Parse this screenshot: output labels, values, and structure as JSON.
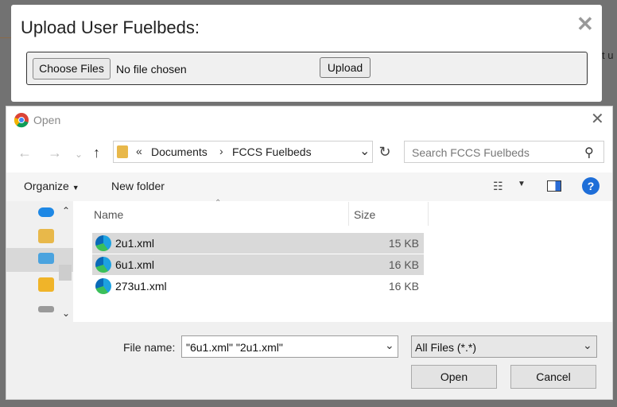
{
  "modal": {
    "title": "Upload User Fuelbeds:",
    "close_glyph": "✕",
    "choose_files_label": "Choose Files",
    "no_file_text": "No file chosen",
    "upload_label": "Upload"
  },
  "background": {
    "peek_text": "t u"
  },
  "dialog": {
    "title": "Open",
    "close_glyph": "✕",
    "address": {
      "overflow_glyph": "«",
      "crumbs": [
        "Documents",
        "FCCS Fuelbeds"
      ],
      "separator": "›"
    },
    "search_placeholder": "Search FCCS Fuelbeds",
    "toolbar": {
      "organize_label": "Organize",
      "new_folder_label": "New folder",
      "help_glyph": "?"
    },
    "columns": {
      "name": "Name",
      "size": "Size"
    },
    "files": [
      {
        "name": "2u1.xml",
        "size": "15 KB"
      },
      {
        "name": "6u1.xml",
        "size": "16 KB"
      },
      {
        "name": "273u1.xml",
        "size": "16 KB"
      }
    ],
    "file_name_label": "File name:",
    "file_name_value": "\"6u1.xml\" \"2u1.xml\"",
    "file_type_value": "All Files (*.*)",
    "open_label": "Open",
    "cancel_label": "Cancel"
  },
  "icons": {
    "back": "arrow-left-icon",
    "forward": "arrow-right-icon",
    "recent": "chevron-down-icon",
    "up": "arrow-up-icon",
    "refresh": "refresh-icon",
    "search": "search-icon",
    "file": "edge-file-icon"
  }
}
